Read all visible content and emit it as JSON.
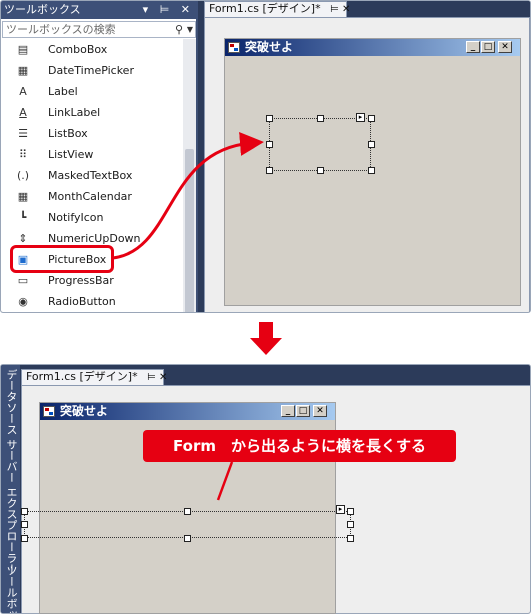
{
  "toolbox": {
    "title": "ツールボックス",
    "title_buttons": "▾ ⊨ ✕",
    "search_placeholder": "ツールボックスの検索",
    "items": [
      {
        "label": "ComboBox",
        "icon": "combobox-icon",
        "glyph": "▤"
      },
      {
        "label": "DateTimePicker",
        "icon": "calendar-icon",
        "glyph": "▦"
      },
      {
        "label": "Label",
        "icon": "label-icon",
        "glyph": "A"
      },
      {
        "label": "LinkLabel",
        "icon": "linklabel-icon",
        "glyph": "A"
      },
      {
        "label": "ListBox",
        "icon": "listbox-icon",
        "glyph": "☰"
      },
      {
        "label": "ListView",
        "icon": "listview-icon",
        "glyph": "⠿"
      },
      {
        "label": "MaskedTextBox",
        "icon": "maskedtextbox-icon",
        "glyph": "(.)"
      },
      {
        "label": "MonthCalendar",
        "icon": "monthcalendar-icon",
        "glyph": "▦"
      },
      {
        "label": "NotifyIcon",
        "icon": "notifyicon-icon",
        "glyph": "┗"
      },
      {
        "label": "NumericUpDown",
        "icon": "numericupdown-icon",
        "glyph": "⇕"
      },
      {
        "label": "PictureBox",
        "icon": "picturebox-icon",
        "glyph": "▣"
      },
      {
        "label": "ProgressBar",
        "icon": "progressbar-icon",
        "glyph": "▭"
      },
      {
        "label": "RadioButton",
        "icon": "radiobutton-icon",
        "glyph": "◉"
      }
    ]
  },
  "designer": {
    "tab_label": "Form1.cs [デザイン]*",
    "tab_buttons": "⊨ ✕",
    "form_title": "突破せよ",
    "caption_min": "_",
    "caption_max": "□",
    "caption_close": "✕",
    "smart_tag": "▸"
  },
  "side_tabs": {
    "data_sources": "データソース",
    "server_explorer": "サーバー エクスプローラー",
    "toolbox": "ツールボックス"
  },
  "annotation": {
    "text": "Form　から出るように横を長くする"
  },
  "colors": {
    "highlight_red": "#e60012",
    "vs_dark_blue": "#2c3b5a",
    "form_gray": "#d4d0c8",
    "caption_start": "#0a246a",
    "caption_end": "#a6caf0"
  }
}
